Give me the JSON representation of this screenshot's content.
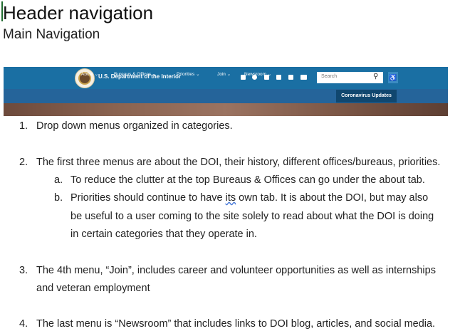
{
  "doc": {
    "title": "Header navigation",
    "subtitle": "Main Navigation"
  },
  "site_header": {
    "agency_name": "U.S. Department of the Interior",
    "search_placeholder": "Search",
    "social_icons": [
      "email-icon",
      "facebook-icon",
      "twitter-icon",
      "tumblr-icon",
      "flickr-icon",
      "youtube-icon"
    ],
    "nav": [
      "About ⌄",
      "Bureaus & Offices ⌄",
      "Priorities ⌄",
      "Join ⌄",
      "Newsroom ⌄"
    ],
    "cta": "Coronavirus Updates",
    "colors": {
      "topbar": "#1a6fa3",
      "navbar": "#25649a",
      "cta": "#10476f"
    }
  },
  "list": {
    "item1": {
      "num": "1.",
      "text": "Drop down menus organized in categories."
    },
    "item2": {
      "num": "2.",
      "text": "The first three menus are about the DOI, their history, different offices/bureaus, priorities.",
      "a": {
        "num": "a.",
        "text": "To reduce the clutter at the top Bureaus & Offices can go under the about tab."
      },
      "b": {
        "num": "b.",
        "line1_pre": "Priorities should continue to have ",
        "line1_word": "its",
        "line1_post": " own tab.  It is about the DOI, but may also",
        "line2": "be useful to a user coming to the site solely to read about what the DOI is doing",
        "line3": "in certain categories that they operate in."
      }
    },
    "item3": {
      "num": "3.",
      "line1": "The 4th menu, “Join”, includes career and volunteer opportunities as well as internships",
      "line2": "and veteran employment"
    },
    "item4": {
      "num": "4.",
      "text": "The last menu is “Newsroom” that includes links to DOI blog, articles, and social media."
    }
  }
}
